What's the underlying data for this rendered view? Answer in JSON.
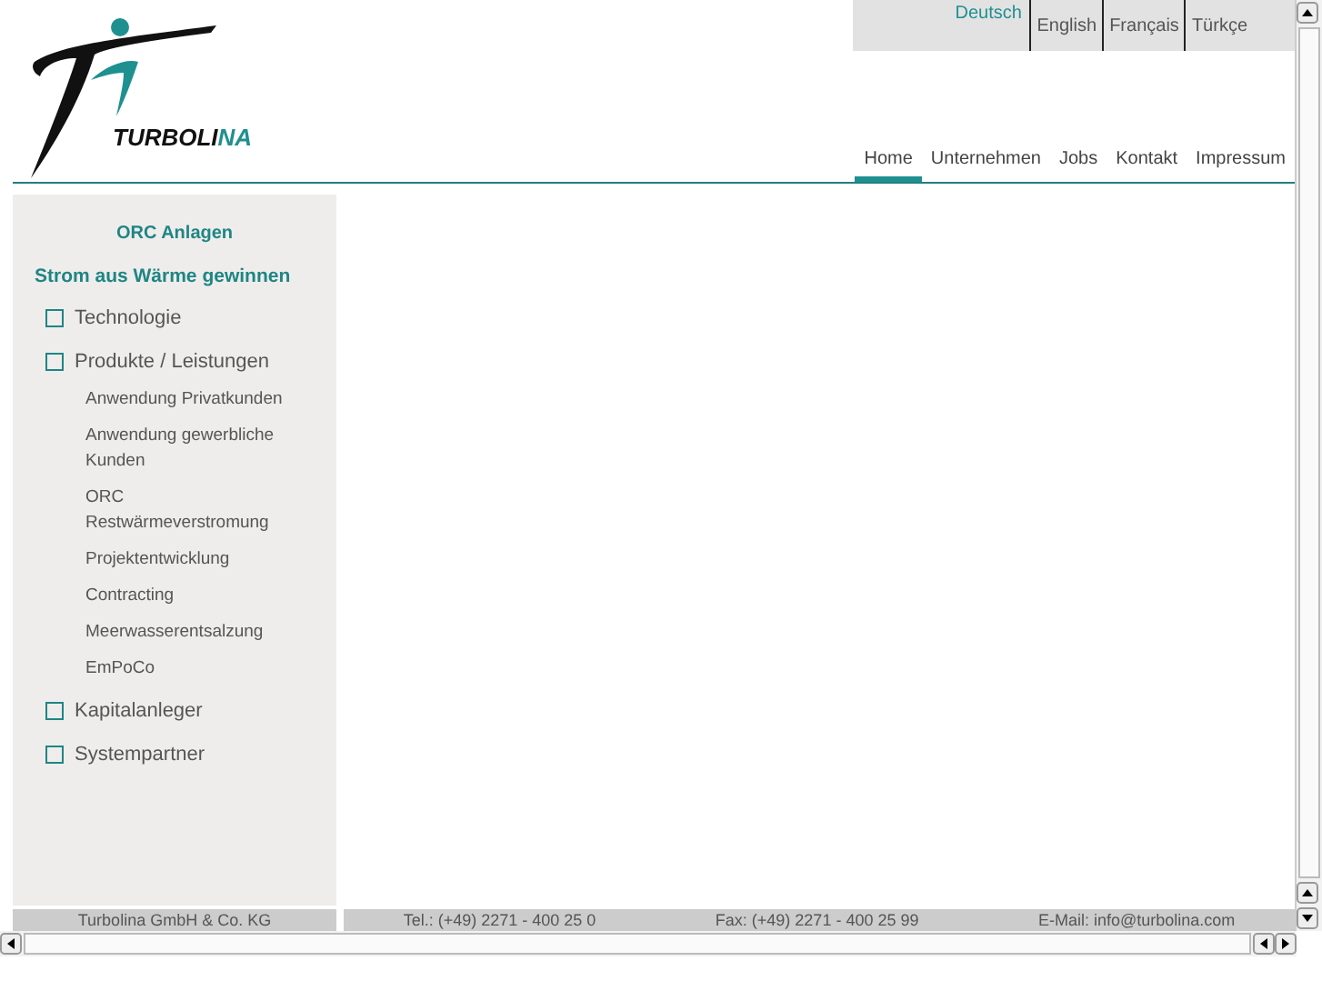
{
  "logo": {
    "text": "TURBOLI",
    "text_accent": "NA"
  },
  "languages": [
    {
      "label": "Deutsch",
      "selected": true
    },
    {
      "label": "English",
      "selected": false
    },
    {
      "label": "Français",
      "selected": false
    },
    {
      "label": "Türkçe",
      "selected": false
    }
  ],
  "nav": [
    {
      "label": "Home",
      "selected": true
    },
    {
      "label": "Unternehmen",
      "selected": false
    },
    {
      "label": "Jobs",
      "selected": false
    },
    {
      "label": "Kontakt",
      "selected": false
    },
    {
      "label": "Impressum",
      "selected": false
    }
  ],
  "sidebar": {
    "title": "ORC Anlagen",
    "subtitle": "Strom aus Wärme gewinnen",
    "items": [
      {
        "label": "Technologie"
      },
      {
        "label": "Produkte / Leistungen",
        "children": [
          {
            "label": "Anwendung Privatkunden"
          },
          {
            "label": "Anwendung gewerbliche Kunden"
          },
          {
            "label": "ORC Restwärmeverstromung"
          },
          {
            "label": "Projektentwicklung"
          },
          {
            "label": "Contracting"
          },
          {
            "label": "Meerwasserentsalzung"
          },
          {
            "label": "EmPoCo"
          }
        ]
      },
      {
        "label": "Kapitalanleger"
      },
      {
        "label": "Systempartner"
      }
    ]
  },
  "footer": {
    "company": "Turbolina GmbH & Co. KG",
    "phone": "Tel.: (+49) 2271 - 400 25 0",
    "fax": "Fax: (+49) 2271 - 400 25 99",
    "email": "E-Mail: info@turbolina.com"
  }
}
